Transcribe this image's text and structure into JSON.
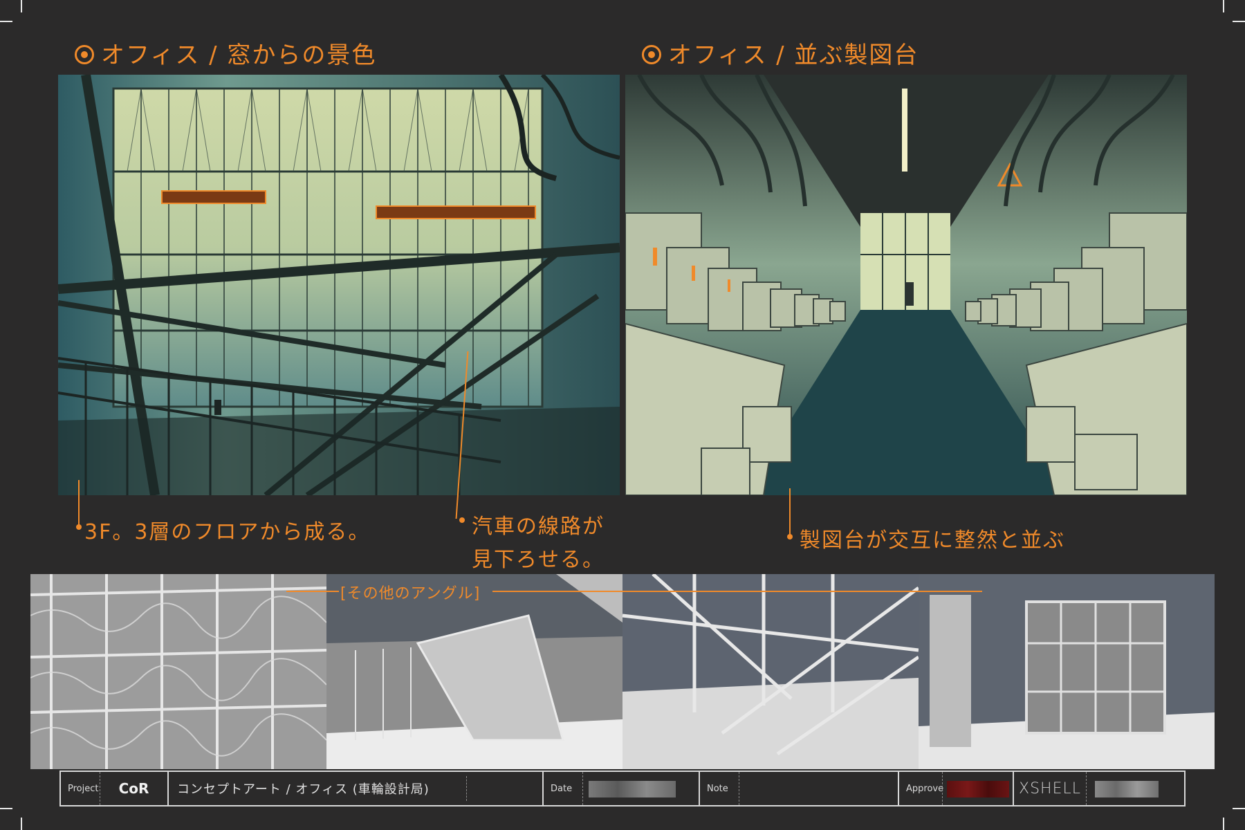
{
  "colors": {
    "accent": "#f08a2a",
    "background": "#2b2a2a",
    "frame": "#d8d8d8"
  },
  "panels": {
    "left": {
      "title": "オフィス / 窓からの景色",
      "annotation_1": "3F。3層のフロアから成る。",
      "annotation_2_line1": "汽車の線路が",
      "annotation_2_line2": "見下ろせる。"
    },
    "right": {
      "title": "オフィス / 並ぶ製図台",
      "annotation": "製図台が交互に整然と並ぶ"
    }
  },
  "other_angles": {
    "label": "[その他のアングル]"
  },
  "footer": {
    "project_label": "Project",
    "project_value": "CoR",
    "description": "コンセプトアート / オフィス (車輪設計局)",
    "date_label": "Date",
    "note_label": "Note",
    "approve_label": "Approve",
    "company_logo": "XSHELL"
  }
}
